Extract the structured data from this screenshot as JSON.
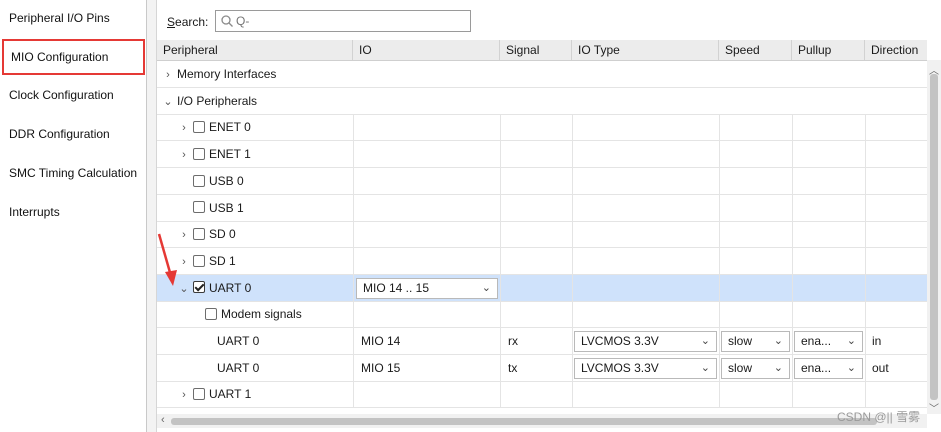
{
  "sidebar": {
    "items": [
      {
        "label": "Peripheral I/O Pins",
        "active": false
      },
      {
        "label": "MIO Configuration",
        "active": true
      },
      {
        "label": "Clock Configuration",
        "active": false
      },
      {
        "label": "DDR Configuration",
        "active": false
      },
      {
        "label": "SMC Timing Calculation",
        "active": false
      },
      {
        "label": "Interrupts",
        "active": false
      }
    ]
  },
  "search": {
    "label_prefix": "S",
    "label_rest": "earch:",
    "placeholder": "Q-",
    "value": ""
  },
  "table": {
    "columns": [
      "Peripheral",
      "IO",
      "Signal",
      "IO Type",
      "Speed",
      "Pullup",
      "Direction"
    ],
    "rows": [
      {
        "peripheral": "Memory Interfaces",
        "kind": "group",
        "expander": "›"
      },
      {
        "peripheral": "I/O Peripherals",
        "kind": "group",
        "expander": "⌄"
      },
      {
        "peripheral": "ENET 0",
        "kind": "item",
        "expander": "›",
        "checked": false
      },
      {
        "peripheral": "ENET 1",
        "kind": "item",
        "expander": "›",
        "checked": false
      },
      {
        "peripheral": "USB 0",
        "kind": "item",
        "checked": false
      },
      {
        "peripheral": "USB 1",
        "kind": "item",
        "checked": false
      },
      {
        "peripheral": "SD 0",
        "kind": "item",
        "expander": "›",
        "checked": false
      },
      {
        "peripheral": "SD 1",
        "kind": "item",
        "expander": "›",
        "checked": false
      },
      {
        "peripheral": "UART 0",
        "kind": "item",
        "expander": "⌄",
        "checked": true,
        "io": "MIO 14 .. 15",
        "selected": true
      },
      {
        "peripheral": "Modem signals",
        "kind": "sub",
        "checked": false
      },
      {
        "peripheral": "UART 0",
        "kind": "signal",
        "io": "MIO 14",
        "signal": "rx",
        "io_type": "LVCMOS 3.3V",
        "speed": "slow",
        "pullup": "ena...",
        "direction": "in"
      },
      {
        "peripheral": "UART 0",
        "kind": "signal",
        "io": "MIO 15",
        "signal": "tx",
        "io_type": "LVCMOS 3.3V",
        "speed": "slow",
        "pullup": "ena...",
        "direction": "out"
      },
      {
        "peripheral": "UART 1",
        "kind": "item",
        "expander": "›",
        "checked": false
      }
    ]
  },
  "icons": {
    "dropdown": "chevron-down-icon",
    "search": "search-icon"
  },
  "colors": {
    "selected_row": "#cfe2fb",
    "active_outline": "#e53935",
    "annotation_arrow": "#e53935"
  },
  "watermark": "CSDN @|| 雪雾"
}
